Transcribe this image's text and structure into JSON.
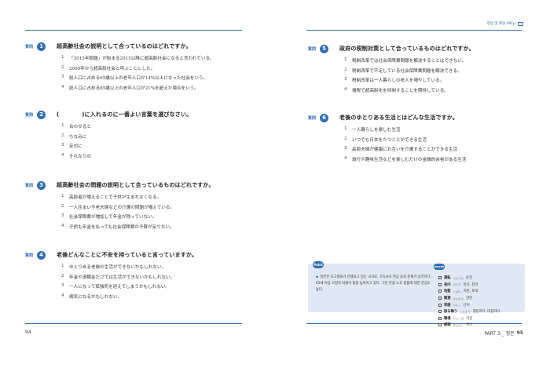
{
  "left_page": {
    "page_number": "94",
    "q_label": "質問",
    "questions": [
      {
        "number": "1",
        "text": "超高齢社会の説明として合っているのはどれですか。",
        "options": [
          {
            "n": "1",
            "text": "「2015年問題」が始まる2015以降に超高齢社会になると言われている。"
          },
          {
            "n": "2",
            "text": "2009年から超高齢社会と呼ぶことにした。"
          },
          {
            "n": "3",
            "text": "総人口に占める65歳以上の老年人口が14%以上になった社会をいう。"
          },
          {
            "n": "4",
            "text": "総人口に占める65歳以上の老年人口が21%を超えた場合をいう。"
          }
        ]
      },
      {
        "number": "2",
        "text": "(　　　　)に入れるのに一番よい言葉を選びなさい。",
        "options": [
          {
            "n": "1",
            "text": "合わせると"
          },
          {
            "n": "2",
            "text": "ちなみに"
          },
          {
            "n": "3",
            "text": "反対に"
          },
          {
            "n": "4",
            "text": "それなりの"
          }
        ]
      },
      {
        "number": "3",
        "text": "超高齢社会の問題の説明として合っているものはどれですか。",
        "options": [
          {
            "n": "1",
            "text": "高齢者が増えることで子供が生まれなくなる。"
          },
          {
            "n": "2",
            "text": "一人住まいや老夫婦などの介護の問題が増えている。"
          },
          {
            "n": "3",
            "text": "社会保障費が増加して年金が残っていない。"
          },
          {
            "n": "4",
            "text": "子供も年金を払っても社会保障費の予算が足りない。"
          }
        ]
      },
      {
        "number": "4",
        "text": "老後どんなことに不安を持っていると言っていますか。",
        "options": [
          {
            "n": "1",
            "text": "ゆとりある老後の生活ができないかもしれない。"
          },
          {
            "n": "2",
            "text": "年金や退職金だけでは生活ができないかもしれない。"
          },
          {
            "n": "3",
            "text": "一人になって孤独死を迎えてしまうかもしれない。"
          },
          {
            "n": "4",
            "text": "病気になるかもしれない。"
          }
        ]
      }
    ]
  },
  "right_page": {
    "running_head": "정답 및 해설 491p",
    "footer_part": "PART 3 _ 정문",
    "page_number": "95",
    "q_label": "質問",
    "questions": [
      {
        "number": "5",
        "text": "政府の税制対策として合っているものはどれですか。",
        "options": [
          {
            "n": "1",
            "text": "税制改革では社会保障費問題を解決することはできない。"
          },
          {
            "n": "2",
            "text": "税制改革で不足している社会保障費問題を解決できる。"
          },
          {
            "n": "3",
            "text": "税制改革は一人暮らしの老人を増やしている。"
          },
          {
            "n": "4",
            "text": "増税で超高齢化を抑制することを期待している。"
          }
        ]
      },
      {
        "number": "6",
        "text": "老後のゆとりある生活とはどんな生活ですか。",
        "options": [
          {
            "n": "1",
            "text": "一人暮らしを楽しむ生活"
          },
          {
            "n": "2",
            "text": "いつでも日本をたつことができる生活"
          },
          {
            "n": "3",
            "text": "高齢夫婦が健康にお互いを介護することができる生活"
          },
          {
            "n": "4",
            "text": "旅行や趣味生活などを楽しむだけの金銭的余裕がある生活"
          }
        ]
      }
    ],
    "point": {
      "badge": "Point",
      "bullet": "◆",
      "text": "일본은 초고령화가 진행되고 있는 국가로, 고독사나 연금 등의 문제가 심각하다. 65세 이상 고령자 비율이 점점 높아지고 있다. 그런 만큼 노후 생활에 대한 관심도 높다."
    },
    "words": {
      "badge": "words",
      "items": [
        {
          "word": "運転",
          "reading": "うんてん",
          "meaning": "운전"
        },
        {
          "word": "身内",
          "reading": "みうち",
          "meaning": "일가, 친척"
        },
        {
          "word": "地盤",
          "reading": "じばん",
          "meaning": "지반, 토대"
        },
        {
          "word": "関連",
          "reading": "かんれん",
          "meaning": "관련"
        },
        {
          "word": "単語",
          "reading": "たんご",
          "meaning": "단어"
        },
        {
          "word": "振る舞う",
          "reading": "ふるまう",
          "meaning": "행동하다, 대접하다"
        },
        {
          "word": "職場",
          "reading": "しょくば",
          "meaning": "직장"
        },
        {
          "word": "銀額",
          "reading": "ぎんがく",
          "meaning": "액수"
        }
      ]
    }
  }
}
